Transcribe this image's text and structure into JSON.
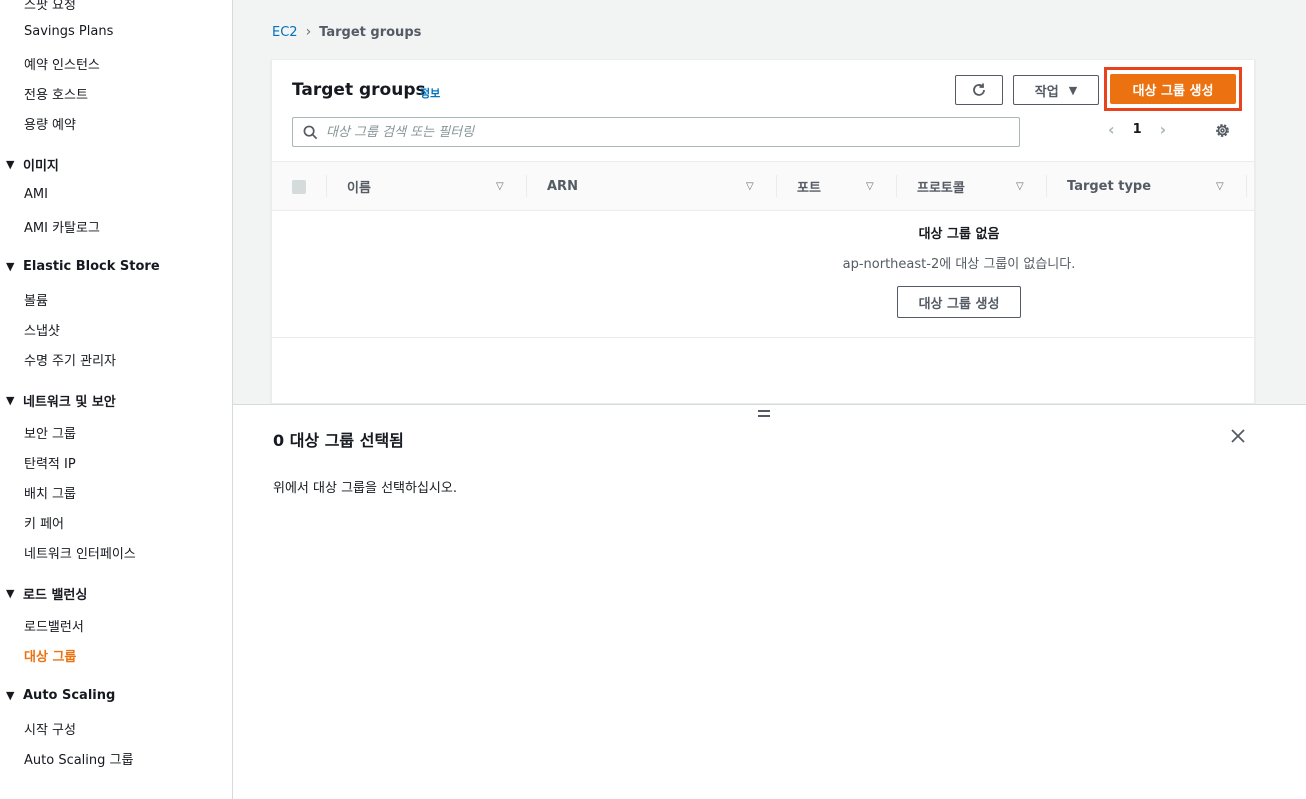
{
  "sidebar": {
    "top_partial": "스팟 요청",
    "items_group1": [
      "Savings Plans",
      "예약 인스턴스",
      "전용 호스트",
      "용량 예약"
    ],
    "section_images": "이미지",
    "items_images": [
      "AMI",
      "AMI 카탈로그"
    ],
    "section_ebs": "Elastic Block Store",
    "items_ebs": [
      "볼륨",
      "스냅샷",
      "수명 주기 관리자"
    ],
    "section_network": "네트워크 및 보안",
    "items_network": [
      "보안 그룹",
      "탄력적 IP",
      "배치 그룹",
      "키 페어",
      "네트워크 인터페이스"
    ],
    "section_lb": "로드 밸런싱",
    "items_lb": [
      "로드밸런서",
      "대상 그룹"
    ],
    "section_as": "Auto Scaling",
    "items_as": [
      "시작 구성",
      "Auto Scaling 그룹"
    ],
    "active_item": "대상 그룹"
  },
  "breadcrumb": {
    "root": "EC2",
    "current": "Target groups"
  },
  "panel": {
    "title": "Target groups",
    "info": "정보",
    "actions_label": "작업",
    "create_label": "대상 그룹 생성",
    "search_placeholder": "대상 그룹 검색 또는 필터링",
    "page_number": "1"
  },
  "table": {
    "columns": [
      "이름",
      "ARN",
      "포트",
      "프로토콜",
      "Target type"
    ]
  },
  "empty_state": {
    "title": "대상 그룹 없음",
    "description": "ap-northeast-2에 대상 그룹이 없습니다.",
    "button_label": "대상 그룹 생성"
  },
  "split_panel": {
    "title": "0 대상 그룹 선택됨",
    "description": "위에서 대상 그룹을 선택하십시오."
  },
  "colors": {
    "accent": "#ec7211",
    "link": "#0073bb",
    "highlight_border": "#e8431c"
  },
  "icons": [
    "refresh-icon",
    "caret-down-icon",
    "search-icon",
    "chevron-left-icon",
    "chevron-right-icon",
    "gear-icon",
    "sort-icon",
    "close-icon",
    "drag-handle-icon"
  ]
}
